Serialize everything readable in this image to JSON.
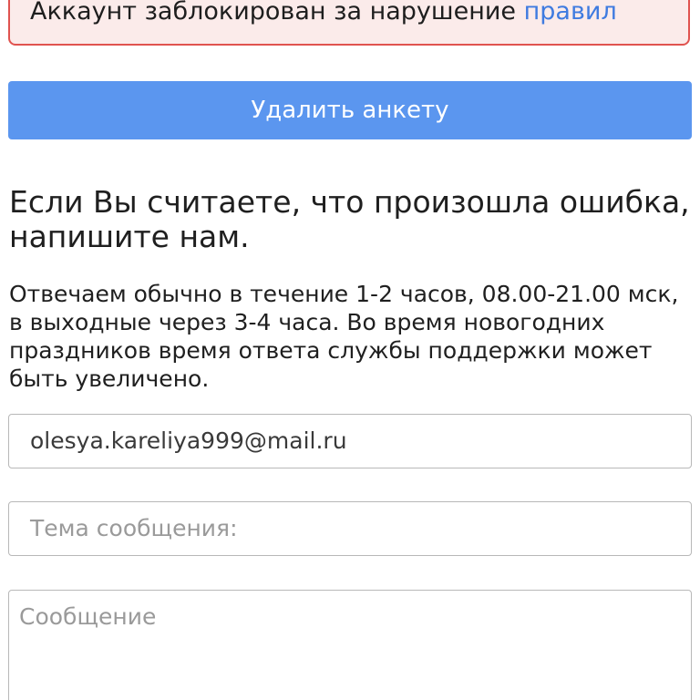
{
  "alert": {
    "text": "Аккаунт заблокирован за нарушение",
    "link_text": "правил"
  },
  "delete_button": {
    "label": "Удалить анкету"
  },
  "heading": "Если Вы считаете, что произошла ошибка, напишите нам.",
  "info": "Отвечаем обычно в течение 1-2 часов, 08.00-21.00 мск, в выходные через 3-4 часа. Во время новогодних праздников время ответа службы поддержки может быть увеличено.",
  "form": {
    "email_value": "olesya.kareliya999@mail.ru",
    "subject_placeholder": "Тема сообщения:",
    "message_placeholder": "Сообщение"
  },
  "colors": {
    "alert_border": "#e0534f",
    "alert_background": "#fbebea",
    "link": "#3f7be0",
    "button": "#5b96ef"
  }
}
